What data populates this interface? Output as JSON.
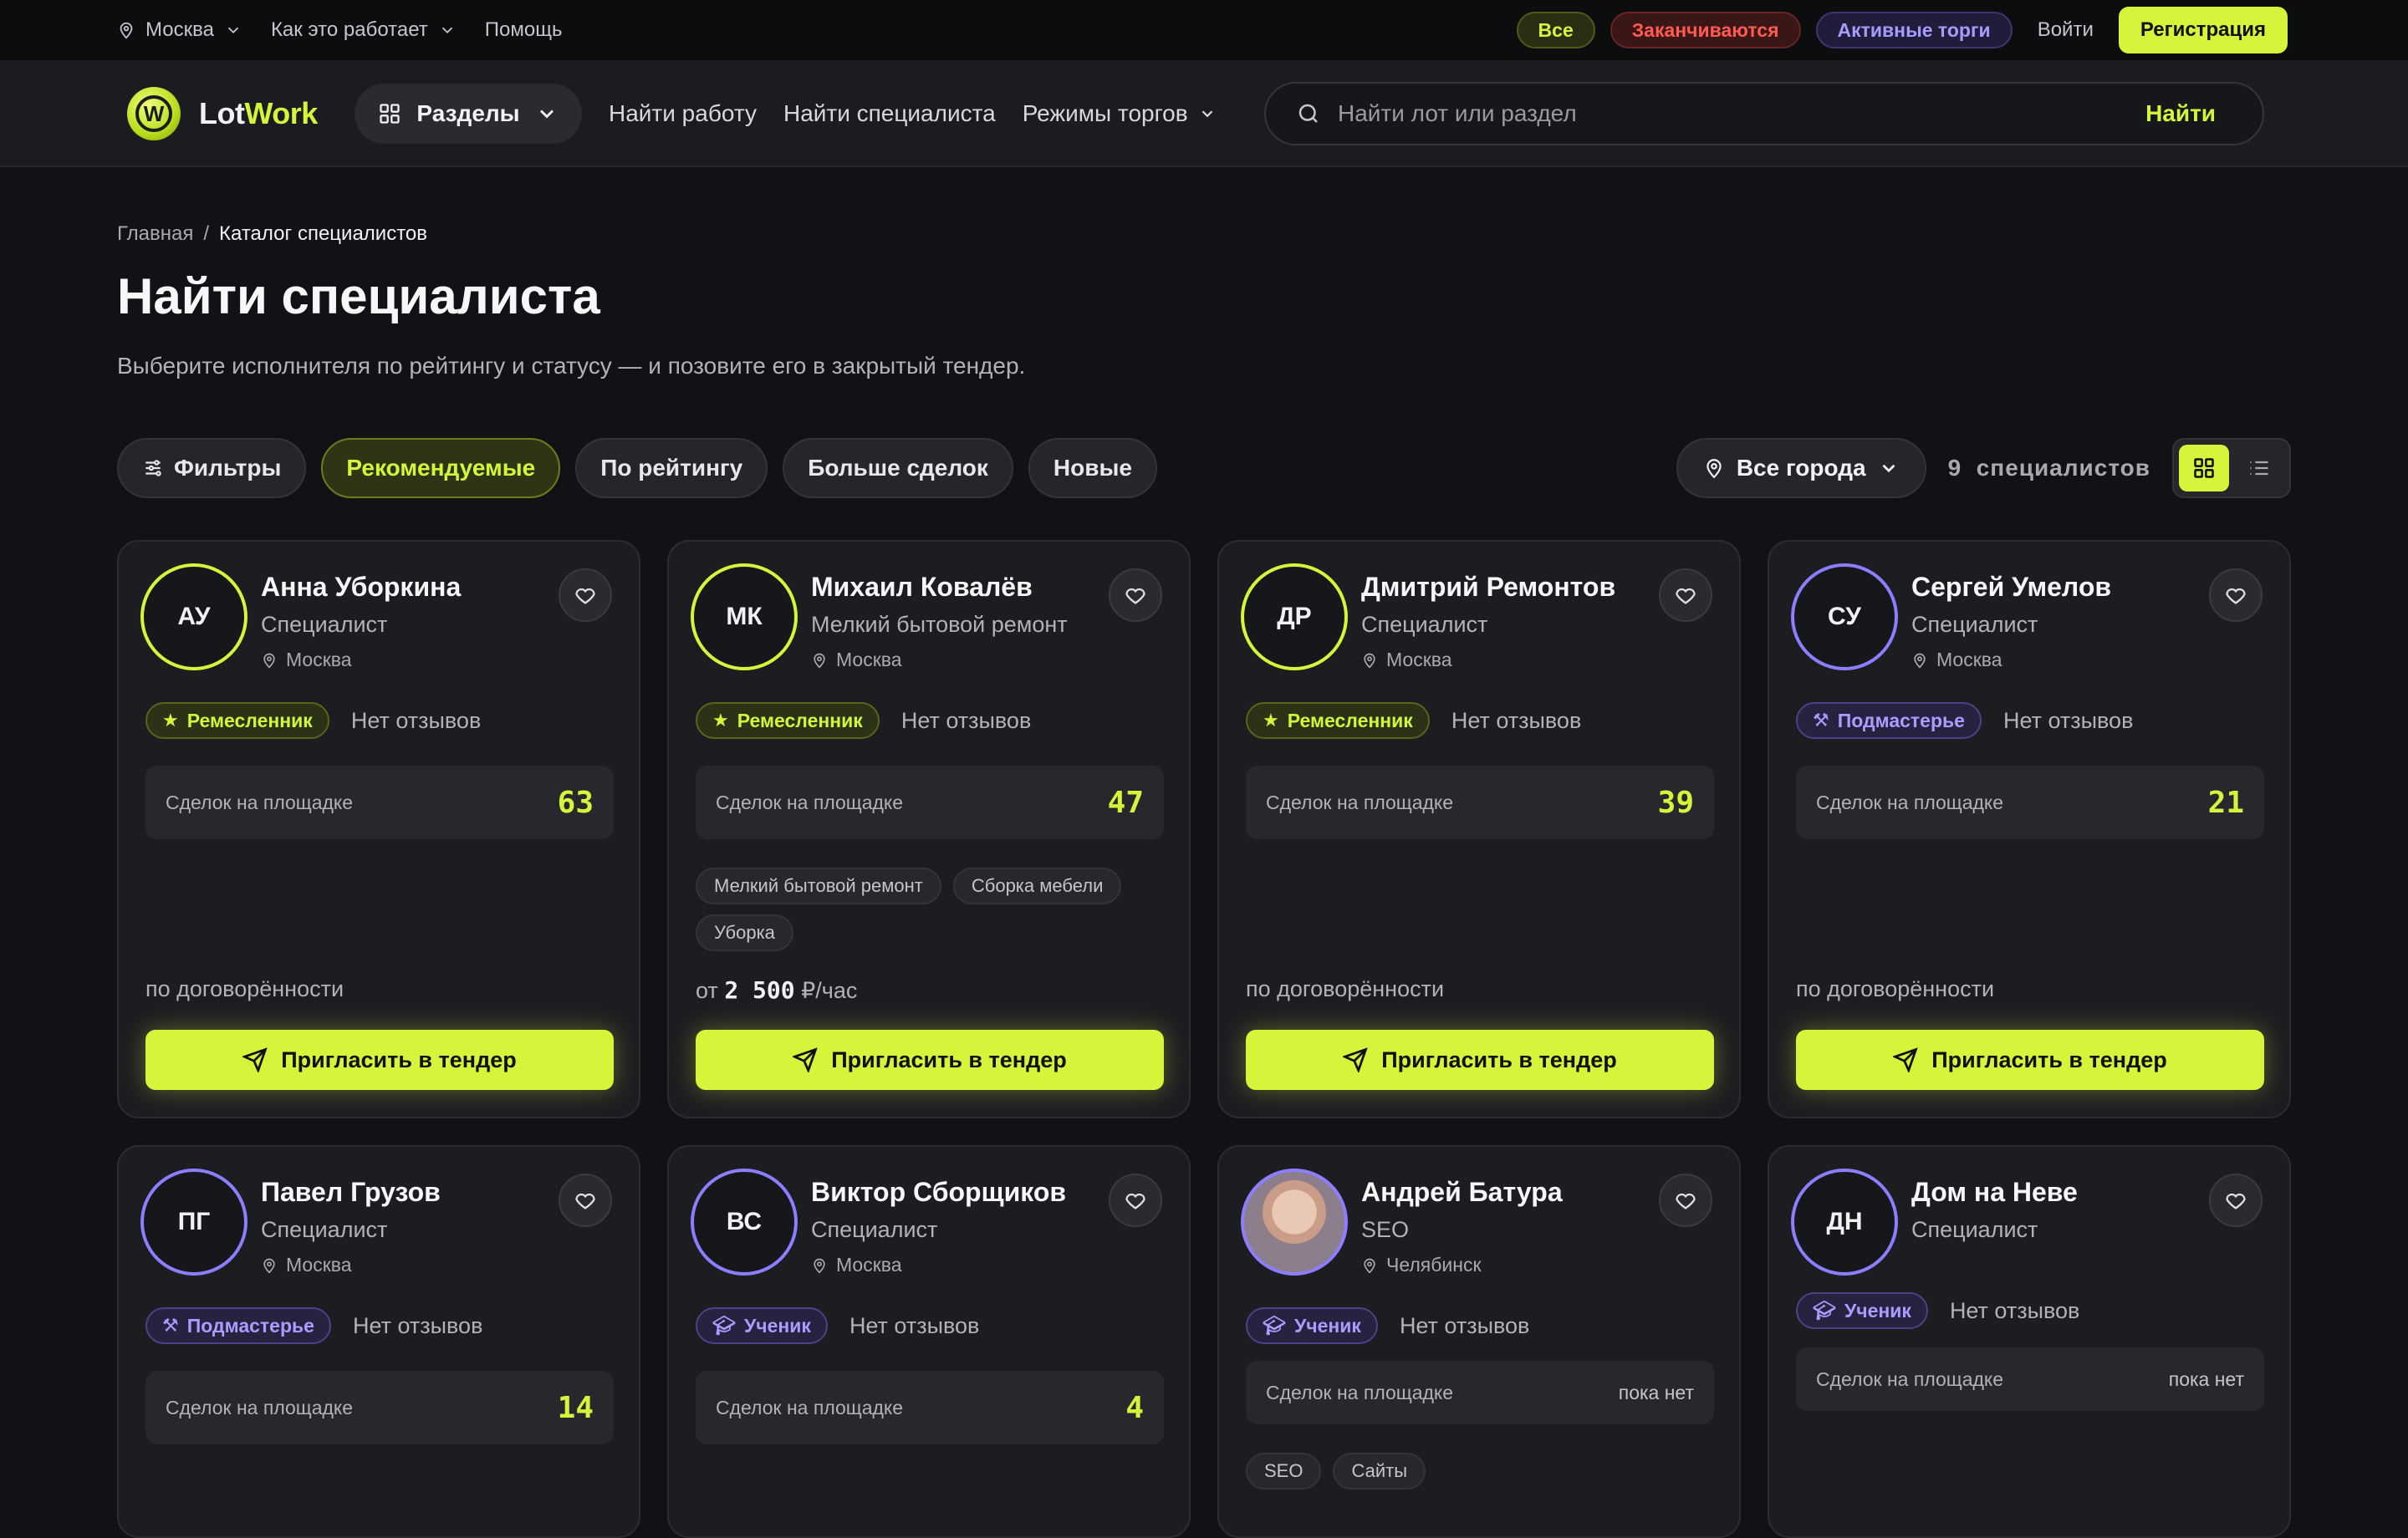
{
  "topbar": {
    "city": "Москва",
    "how_it_works": "Как это работает",
    "help": "Помощь",
    "pills": {
      "all": "Все",
      "ending": "Заканчиваются",
      "active": "Активные торги"
    },
    "login": "Войти",
    "register": "Регистрация"
  },
  "header": {
    "logo_a": "Lot",
    "logo_b": "Work",
    "sections": "Разделы",
    "nav": {
      "find_job": "Найти работу",
      "find_specialist": "Найти специалиста",
      "modes": "Режимы торгов"
    },
    "search_placeholder": "Найти лот или раздел",
    "search_button": "Найти"
  },
  "breadcrumb": {
    "home": "Главная",
    "sep": "/",
    "current": "Каталог специалистов"
  },
  "page": {
    "title": "Найти специалиста",
    "subtitle": "Выберите исполнителя по рейтингу и статусу — и позовите его в закрытый тендер."
  },
  "filters": {
    "filters": "Фильтры",
    "recommended": "Рекомендуемые",
    "by_rating": "По рейтингу",
    "more_deals": "Больше сделок",
    "new": "Новые",
    "city": "Все города",
    "count_num": "9",
    "count_label": "специалистов"
  },
  "labels": {
    "deals": "Сделок на площадке",
    "no_reviews": "Нет отзывов",
    "invite": "Пригласить в тендер",
    "negotiable": "по договорённости",
    "price_from": "от",
    "price_unit": "₽/час",
    "none_yet": "пока нет"
  },
  "colors": {
    "accent": "#d6f53a",
    "violet": "#8d7dff",
    "bg": "#111215",
    "card": "#1c1d21"
  },
  "cards": [
    {
      "initials": "АУ",
      "name": "Анна Уборкина",
      "role": "Специалист",
      "city": "Москва",
      "rank": "Ремесленник",
      "deals": "63"
    },
    {
      "initials": "МК",
      "name": "Михаил Ковалёв",
      "role": "Мелкий бытовой ремонт",
      "city": "Москва",
      "rank": "Ремесленник",
      "deals": "47",
      "tags": [
        "Мелкий бытовой ремонт",
        "Сборка мебели",
        "Уборка"
      ],
      "price": "2 500"
    },
    {
      "initials": "ДР",
      "name": "Дмитрий Ремонтов",
      "role": "Специалист",
      "city": "Москва",
      "rank": "Ремесленник",
      "deals": "39"
    },
    {
      "initials": "СУ",
      "name": "Сергей Умелов",
      "role": "Специалист",
      "city": "Москва",
      "rank": "Подмастерье",
      "deals": "21"
    },
    {
      "initials": "ПГ",
      "name": "Павел Грузов",
      "role": "Специалист",
      "city": "Москва",
      "rank": "Подмастерье",
      "deals": "14"
    },
    {
      "initials": "ВС",
      "name": "Виктор Сборщиков",
      "role": "Специалист",
      "city": "Москва",
      "rank": "Ученик",
      "deals": "4"
    },
    {
      "name": "Андрей Батура",
      "role": "SEO",
      "city": "Челябинск",
      "rank": "Ученик",
      "tags": [
        "SEO",
        "Сайты"
      ]
    },
    {
      "initials": "ДН",
      "name": "Дом на Неве",
      "role": "Специалист",
      "rank": "Ученик"
    }
  ]
}
